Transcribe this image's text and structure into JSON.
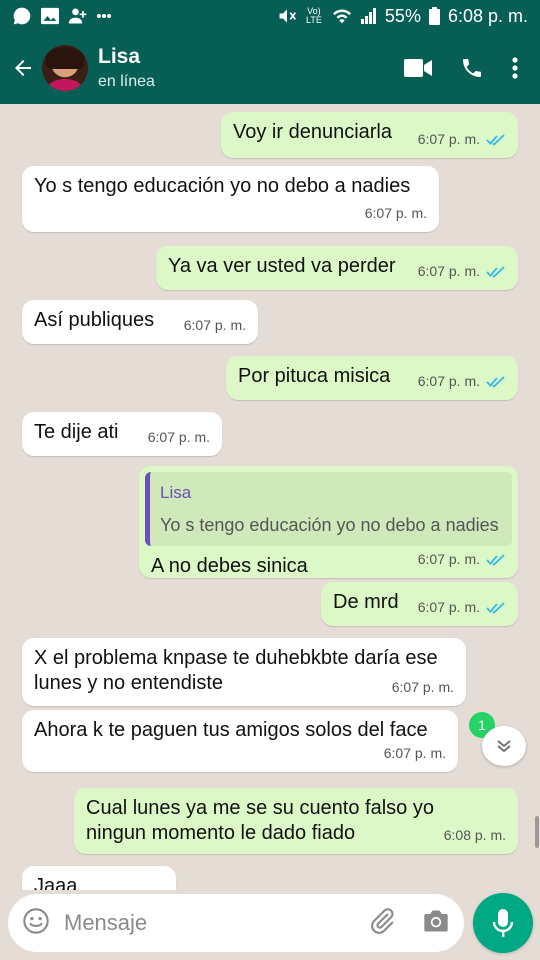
{
  "statusbar": {
    "battery": "55%",
    "time": "6:08 p. m.",
    "volte_label": "Vo) LTE"
  },
  "header": {
    "contact_name": "Lisa",
    "contact_status": "en línea"
  },
  "messages": [
    {
      "dir": "out",
      "text": "Voy ir denunciarla",
      "time": "6:07 p. m."
    },
    {
      "dir": "in",
      "text": "Yo s tengo educación yo no debo a nadies",
      "time": "6:07 p. m."
    },
    {
      "dir": "out",
      "text": "Ya va ver usted va perder",
      "time": "6:07 p. m."
    },
    {
      "dir": "in",
      "text": "Así publiques",
      "time": "6:07 p. m."
    },
    {
      "dir": "out",
      "text": "Por pituca misica",
      "time": "6:07 p. m."
    },
    {
      "dir": "in",
      "text": "Te dije ati",
      "time": "6:07 p. m."
    },
    {
      "dir": "out",
      "text": "A no debes sinica",
      "time": "6:07 p. m.",
      "quote_name": "Lisa",
      "quote_text": "Yo s tengo educación yo no debo a nadies"
    },
    {
      "dir": "out",
      "text": "De mrd",
      "time": "6:07 p. m."
    },
    {
      "dir": "in",
      "text": "X el problema knpase te duhebkbte daría ese lunes y no entendiste",
      "time": "6:07 p. m."
    },
    {
      "dir": "in",
      "text": "Ahora k te paguen tus amigos solos del face",
      "time": "6:07 p. m."
    },
    {
      "dir": "out",
      "text": "Cual lunes ya me se su cuento falso yo ningun momento le dado fiado",
      "time": "6:08 p. m."
    },
    {
      "dir": "in",
      "text": "Jaaa",
      "time": ""
    }
  ],
  "unread_count": "1",
  "composer": {
    "placeholder": "Mensaje"
  },
  "colors": {
    "header": "#075e54",
    "outgoing_bubble": "#dcf8c6",
    "incoming_bubble": "#ffffff",
    "read_ticks": "#34b7f1",
    "mic_button": "#00a884"
  },
  "icons": [
    "back-arrow-icon",
    "video-call-icon",
    "phone-icon",
    "more-vert-icon",
    "emoji-icon",
    "attach-icon",
    "camera-icon",
    "mic-icon",
    "chevron-down-icon"
  ]
}
